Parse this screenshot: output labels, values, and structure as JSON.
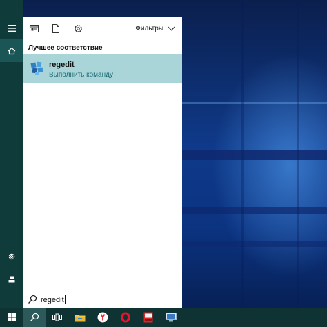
{
  "start_panel": {
    "filters_label": "Фильтры",
    "section_title": "Лучшее соответствие",
    "best_match": {
      "name": "regedit",
      "subtitle": "Выполнить команду"
    }
  },
  "search": {
    "value": "regedit"
  },
  "colors": {
    "rail": "#0f3b3b",
    "rail_active": "#1a5656",
    "result_highlight": "#a9d4d8",
    "subtitle_text": "#1d6d75",
    "taskbar": "#0f3232"
  },
  "icons": {
    "rail": [
      "hamburger-menu-icon",
      "home-icon",
      "settings-icon",
      "user-icon"
    ],
    "topbar": [
      "apps-icon",
      "documents-icon",
      "gear-icon",
      "chevron-down-icon"
    ],
    "taskbar": [
      "search-icon",
      "task-view-icon",
      "file-explorer-icon",
      "yandex-browser-icon",
      "opera-icon",
      "app-tm-icon",
      "app-remote-icon"
    ]
  }
}
